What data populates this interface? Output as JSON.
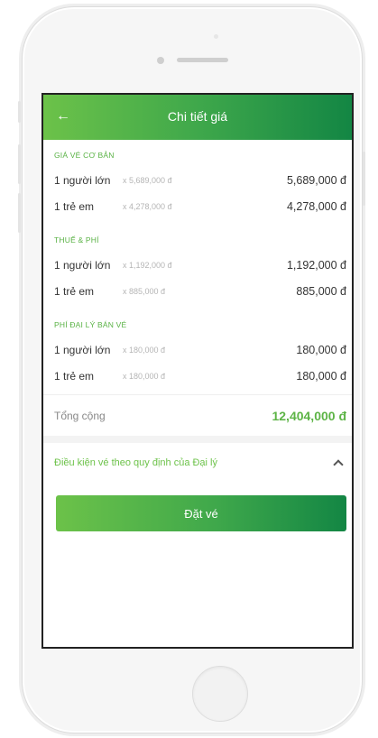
{
  "header": {
    "back_icon": "arrow-left-icon",
    "title": "Chi tiết giá"
  },
  "sections": [
    {
      "title": "GIÁ VÉ CƠ BẢN",
      "rows": [
        {
          "label": "1 người lớn",
          "calc": "x 5,689,000 đ",
          "amount": "5,689,000 đ"
        },
        {
          "label": "1 trẻ em",
          "calc": "x 4,278,000 đ",
          "amount": "4,278,000 đ"
        }
      ]
    },
    {
      "title": "THUẾ & PHÍ",
      "rows": [
        {
          "label": "1 người lớn",
          "calc": "x 1,192,000 đ",
          "amount": "1,192,000 đ"
        },
        {
          "label": "1 trẻ em",
          "calc": "x 885,000 đ",
          "amount": "885,000 đ"
        }
      ]
    },
    {
      "title": "PHÍ ĐẠI LÝ BÁN VÉ",
      "rows": [
        {
          "label": "1 người lớn",
          "calc": "x 180,000 đ",
          "amount": "180,000 đ"
        },
        {
          "label": "1 trẻ em",
          "calc": "x 180,000 đ",
          "amount": "180,000 đ"
        }
      ]
    }
  ],
  "total": {
    "label": "Tổng cộng",
    "amount": "12,404,000 đ"
  },
  "conditions": {
    "text": "Điều kiện vé theo quy định của Đại lý",
    "icon": "chevron-up-icon"
  },
  "book_button": {
    "label": "Đặt vé"
  },
  "colors": {
    "brand_green": "#3fa84b",
    "accent_green": "#6cc249",
    "dark_green": "#138644"
  }
}
